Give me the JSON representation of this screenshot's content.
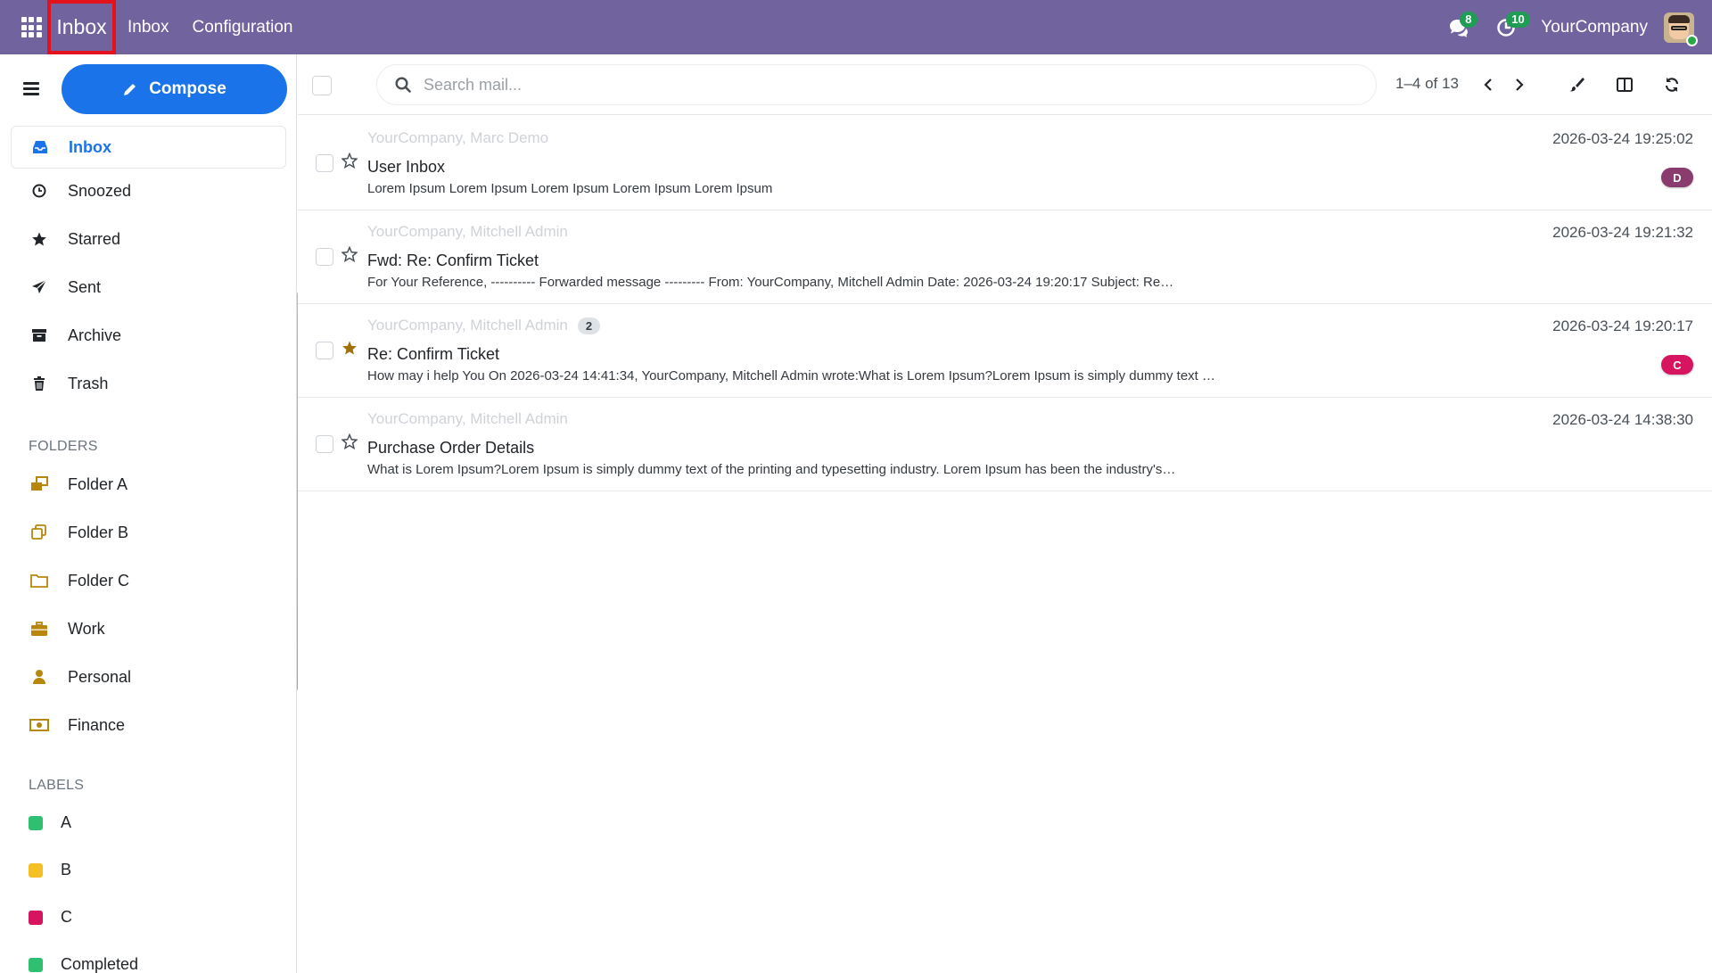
{
  "topbar": {
    "brand": "Inbox",
    "menus": [
      "Inbox",
      "Configuration"
    ],
    "messages_count": "8",
    "activities_count": "10",
    "company": "YourCompany"
  },
  "sidebar": {
    "compose_label": "Compose",
    "nav": [
      {
        "label": "Inbox",
        "icon": "inbox-icon"
      },
      {
        "label": "Snoozed",
        "icon": "clock-icon"
      },
      {
        "label": "Starred",
        "icon": "star-icon"
      },
      {
        "label": "Sent",
        "icon": "paper-plane-icon"
      },
      {
        "label": "Archive",
        "icon": "archive-icon"
      },
      {
        "label": "Trash",
        "icon": "trash-icon"
      }
    ],
    "folders_title": "FOLDERS",
    "folders": [
      {
        "label": "Folder A",
        "icon": "folders-icon"
      },
      {
        "label": "Folder B",
        "icon": "copy-folder-icon"
      },
      {
        "label": "Folder C",
        "icon": "folder-icon"
      },
      {
        "label": "Work",
        "icon": "briefcase-icon"
      },
      {
        "label": "Personal",
        "icon": "user-icon"
      },
      {
        "label": "Finance",
        "icon": "money-icon"
      }
    ],
    "labels_title": "LABELS",
    "labels": [
      {
        "label": "A",
        "color": "#2fbf71"
      },
      {
        "label": "B",
        "color": "#f4c025"
      },
      {
        "label": "C",
        "color": "#d6145f"
      },
      {
        "label": "Completed",
        "color": "#2fbf71"
      }
    ]
  },
  "toolbar": {
    "search_placeholder": "Search mail...",
    "pager": "1–4 of 13"
  },
  "mails": [
    {
      "from": "YourCompany, Marc Demo",
      "subject": "User Inbox",
      "preview": "Lorem Ipsum Lorem Ipsum Lorem Ipsum Lorem Ipsum Lorem Ipsum",
      "date": "2026-03-24 19:25:02",
      "starred": false,
      "tag": "D",
      "tag_color": "#8a3c6e",
      "count": ""
    },
    {
      "from": "YourCompany, Mitchell Admin",
      "subject": "Fwd: Re: Confirm Ticket",
      "preview": "For Your Reference, ---------- Forwarded message --------- From: YourCompany, Mitchell Admin Date: 2026-03-24 19:20:17 Subject: Re…",
      "date": "2026-03-24 19:21:32",
      "starred": false,
      "tag": "",
      "tag_color": "",
      "count": ""
    },
    {
      "from": "YourCompany, Mitchell Admin",
      "subject": "Re: Confirm Ticket",
      "preview": "How may i help You On 2026-03-24 14:41:34, YourCompany, Mitchell Admin wrote:What is Lorem Ipsum?Lorem Ipsum is simply dummy text …",
      "date": "2026-03-24 19:20:17",
      "starred": true,
      "tag": "C",
      "tag_color": "#d6145f",
      "count": "2"
    },
    {
      "from": "YourCompany, Mitchell Admin",
      "subject": "Purchase Order Details",
      "preview": "What is Lorem Ipsum?Lorem Ipsum is simply dummy text of the printing and typesetting industry. Lorem Ipsum has been the industry's…",
      "date": "2026-03-24 14:38:30",
      "starred": false,
      "tag": "",
      "tag_color": "",
      "count": ""
    }
  ]
}
